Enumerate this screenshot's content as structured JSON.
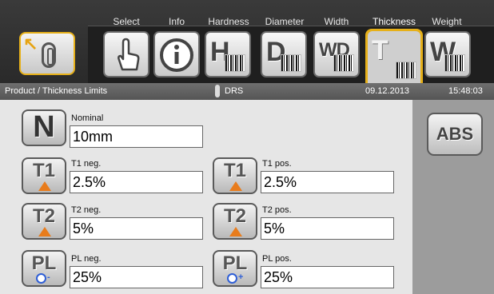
{
  "toolbar": {
    "tabs": [
      {
        "label": "Select"
      },
      {
        "label": "Info"
      },
      {
        "label": "Hardness",
        "letters": "H"
      },
      {
        "label": "Diameter",
        "letters": "D"
      },
      {
        "label": "Width",
        "letters": "WD"
      },
      {
        "label": "Thickness",
        "letters": "T",
        "active": true
      },
      {
        "label": "Weight",
        "letters": "W"
      }
    ]
  },
  "status": {
    "breadcrumb": "Product / Thickness Limits",
    "system": "DRS",
    "date": "09.12.2013",
    "time": "15:48:03"
  },
  "side": {
    "abs_label": "ABS"
  },
  "params": {
    "nominal": {
      "badge": "N",
      "label": "Nominal",
      "value": "10mm"
    },
    "t1_neg": {
      "badge": "T1",
      "label": "T1 neg.",
      "value": "2.5%"
    },
    "t1_pos": {
      "badge": "T1",
      "label": "T1 pos.",
      "value": "2.5%"
    },
    "t2_neg": {
      "badge": "T2",
      "label": "T2 neg.",
      "value": "5%"
    },
    "t2_pos": {
      "badge": "T2",
      "label": "T2 pos.",
      "value": "5%"
    },
    "pl_neg": {
      "badge": "PL",
      "label": "PL neg.",
      "value": "25%",
      "sign": "-"
    },
    "pl_pos": {
      "badge": "PL",
      "label": "PL pos.",
      "value": "25%",
      "sign": "+"
    }
  },
  "colors": {
    "accent": "#e6b019",
    "warning": "#e87c1c",
    "pl_icon": "#2f5fd6"
  }
}
